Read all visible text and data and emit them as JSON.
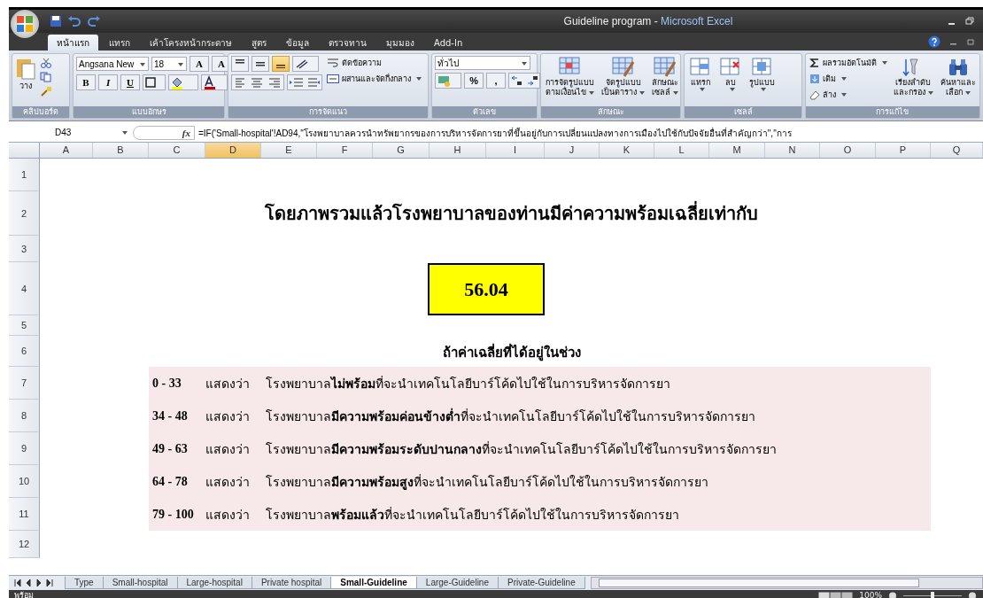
{
  "window": {
    "document_title": "Guideline program",
    "separator": "-",
    "app_title": "Microsoft Excel"
  },
  "ribbon_tabs": [
    {
      "label": "หน้าแรก",
      "selected": true
    },
    {
      "label": "แทรก",
      "selected": false
    },
    {
      "label": "เค้าโครงหน้ากระดาษ",
      "selected": false
    },
    {
      "label": "สูตร",
      "selected": false
    },
    {
      "label": "ข้อมูล",
      "selected": false
    },
    {
      "label": "ตรวจทาน",
      "selected": false
    },
    {
      "label": "มุมมอง",
      "selected": false
    },
    {
      "label": "Add-In",
      "selected": false
    }
  ],
  "clipboard": {
    "paste": "วาง",
    "group": "คลิปบอร์ด"
  },
  "font": {
    "name": "Angsana New",
    "size": "18",
    "grow": "A",
    "shrink": "A",
    "bold": "B",
    "italic": "I",
    "underline": "U",
    "group": "แบบอักษร"
  },
  "alignment": {
    "vertical": [
      {
        "selected": false
      },
      {
        "selected": false
      },
      {
        "selected": true
      }
    ],
    "wrap": "ตัดข้อความ",
    "merge": "ผสานและจัดกึ่งกลาง",
    "group": "การจัดแนว"
  },
  "number": {
    "format": "ทั่วไป",
    "percent": "%",
    "comma": ",",
    "group": "ตัวเลข"
  },
  "styles": {
    "buttons": [
      [
        "การจัดรูปแบบ",
        "ตามเงื่อนไข"
      ],
      [
        "จัดรูปแบบ",
        "เป็นตาราง"
      ],
      [
        "ลักษณะ",
        "เซลล์"
      ]
    ],
    "group": "ลักษณะ"
  },
  "cells": {
    "buttons": [
      "แทรก",
      "ลบ",
      "รูปแบบ"
    ],
    "group": "เซลล์"
  },
  "editing": {
    "autosum": "ผลรวมอัตโนมัติ",
    "fill": "เติม",
    "clear": "ล้าง",
    "sort": [
      "เรียงลำดับ",
      "และกรอง"
    ],
    "find": [
      "ค้นหาและ",
      "เลือก"
    ],
    "group": "การแก้ไข"
  },
  "formula_bar": {
    "name_box": "D43",
    "fx": "fx",
    "formula": "=IF('Small-hospital'!AD94,\"โรงพยาบาลควรนำทรัพยากรของการบริหารจัดการยาที่ขึ้นอยู่กับการเปลี่ยนแปลงทางการเมืองไปใช้กับปัจจัยอื่นที่สำคัญกว่า\",\"การ"
  },
  "columns": [
    "A",
    "B",
    "C",
    "D",
    "E",
    "F",
    "G",
    "H",
    "I",
    "J",
    "K",
    "L",
    "M",
    "N",
    "O",
    "P",
    "Q"
  ],
  "rows": [
    "1",
    "2",
    "3",
    "4",
    "5",
    "6",
    "7",
    "8",
    "9",
    "10",
    "11",
    "12"
  ],
  "sheet": {
    "title": "โดยภาพรวมแล้วโรงพยาบาลของท่านมีค่าความพร้อมเฉลี่ยเท่ากับ",
    "score": "56.04",
    "range_heading": "ถ้าค่าเฉลี่ยที่ได้อยู่ในช่วง",
    "ranges": [
      {
        "range": "0 - 33",
        "verb": "แสดงว่า",
        "meaning": "โรงพยาบาล**ไม่พร้อม**ที่จะนำเทคโนโลยีบาร์โค้ดไปใช้ในการบริหารจัดการยา"
      },
      {
        "range": "34 - 48",
        "verb": "แสดงว่า",
        "meaning": "โรงพยาบาล**มีความพร้อมค่อนข้างต่ำ**ที่จะนำเทคโนโลยีบาร์โค้ดไปใช้ในการบริหารจัดการยา"
      },
      {
        "range": "49 - 63",
        "verb": "แสดงว่า",
        "meaning": "โรงพยาบาล**มีความพร้อมระดับปานกลาง**ที่จะนำเทคโนโลยีบาร์โค้ดไปใช้ในการบริหารจัดการยา"
      },
      {
        "range": "64 - 78",
        "verb": "แสดงว่า",
        "meaning": "โรงพยาบาล**มีความพร้อมสูง**ที่จะนำเทคโนโลยีบาร์โค้ดไปใช้ในการบริหารจัดการยา"
      },
      {
        "range": "79 - 100",
        "verb": "แสดงว่า",
        "meaning": "โรงพยาบาล**พร้อมแล้ว**ที่จะนำเทคโนโลยีบาร์โค้ดไปใช้ในการบริหารจัดการยา"
      }
    ]
  },
  "sheet_tabs": [
    {
      "label": "Type",
      "selected": false
    },
    {
      "label": "Small-hospital",
      "selected": false
    },
    {
      "label": "Large-hospital",
      "selected": false
    },
    {
      "label": "Private hospital",
      "selected": false
    },
    {
      "label": "Small-Guideline",
      "selected": true
    },
    {
      "label": "Large-Guideline",
      "selected": false
    },
    {
      "label": "Private-Guideline",
      "selected": false
    }
  ],
  "status_bar": {
    "status": "พร้อม",
    "zoom": "100%",
    "level": 0.5
  }
}
